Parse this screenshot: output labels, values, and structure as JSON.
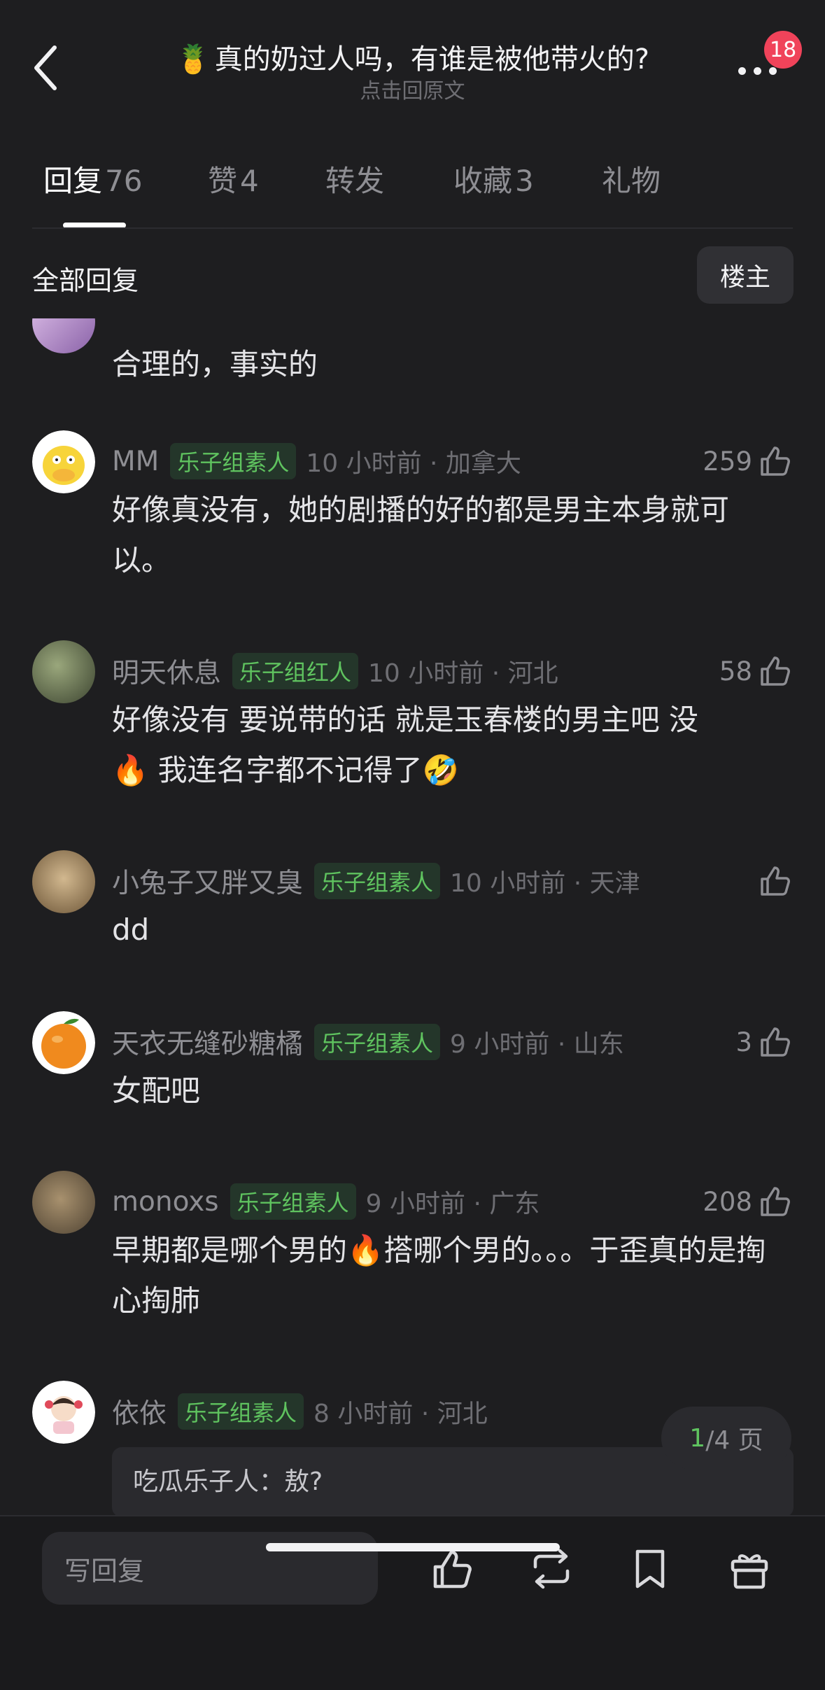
{
  "header": {
    "title_emoji": "🍍",
    "title": "真的奶过人吗，有谁是被他带火的?",
    "subtitle": "点击回原文",
    "notification_count": "18"
  },
  "tabs": [
    {
      "label": "回复",
      "count": "76",
      "active": true
    },
    {
      "label": "赞",
      "count": "4",
      "active": false
    },
    {
      "label": "转发",
      "count": "",
      "active": false
    },
    {
      "label": "收藏",
      "count": "3",
      "active": false
    },
    {
      "label": "礼物",
      "count": "",
      "active": false
    }
  ],
  "filter": {
    "label": "全部回复",
    "op_only_button": "楼主"
  },
  "comments": [
    {
      "name": "",
      "tag": "",
      "time": "",
      "likes": "",
      "text": "合理的，事实的",
      "avatar_colors": [
        "#c9a7d8",
        "#7a5a9a"
      ]
    },
    {
      "name": "MM",
      "tag": "乐子组素人",
      "time": "10 小时前 · 加拿大",
      "likes": "259",
      "text": "好像真没有，她的剧播的好的都是男主本身就可以。",
      "avatar_colors": [
        "#f7d43a",
        "#ffffff"
      ]
    },
    {
      "name": "明天休息",
      "tag": "乐子组红人",
      "time": "10 小时前 · 河北",
      "likes": "58",
      "text_parts": [
        "好像没有 要说带的话 就是玉春楼的男主吧 没",
        "🔥",
        " 我连名字都不记得了",
        "🤣"
      ],
      "avatar_colors": [
        "#6f7a5a",
        "#3c4430"
      ]
    },
    {
      "name": "小兔子又胖又臭",
      "tag": "乐子组素人",
      "time": "10 小时前 · 天津",
      "likes": "",
      "text": "dd",
      "avatar_colors": [
        "#b89a72",
        "#7d6444"
      ]
    },
    {
      "name": "天衣无缝砂糖橘",
      "tag": "乐子组素人",
      "time": "9 小时前 · 山东",
      "likes": "3",
      "text": "女配吧",
      "avatar_colors": [
        "#f08a1e",
        "#ffffff"
      ]
    },
    {
      "name": "monoxs",
      "tag": "乐子组素人",
      "time": "9 小时前 · 广东",
      "likes": "208",
      "text_parts": [
        "早期都是哪个男的",
        "🔥",
        "搭哪个男的。。。于歪真的是掏心掏肺"
      ],
      "avatar_colors": [
        "#8a7456",
        "#4e4232"
      ]
    },
    {
      "name": "依依",
      "tag": "乐子组素人",
      "time": "8 小时前 · 河北",
      "likes": "",
      "sub_reply": "吃瓜乐子人：敖?",
      "avatar_colors": [
        "#f3c6cf",
        "#ffffff"
      ]
    }
  ],
  "pagination": {
    "current": "1",
    "rest": "/4 页"
  },
  "bottom_bar": {
    "input_placeholder": "写回复",
    "icons": [
      "thumb-up-icon",
      "repost-icon",
      "bookmark-icon",
      "gift-icon"
    ]
  }
}
